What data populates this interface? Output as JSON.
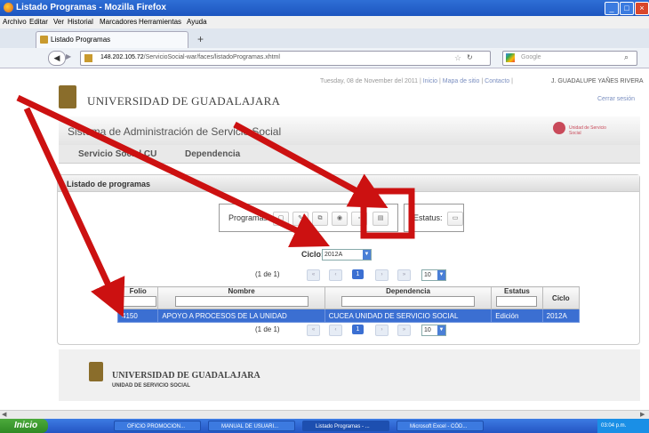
{
  "window": {
    "title": "Listado Programas - Mozilla Firefox"
  },
  "menu": [
    "Archivo",
    "Editar",
    "Ver",
    "Historial",
    "Marcadores",
    "Herramientas",
    "Ayuda"
  ],
  "tab": {
    "label": "Listado Programas",
    "new_tab": "+"
  },
  "address": {
    "host": "148.202.105.72",
    "path": "/ServicioSocial-war/faces/listadoProgramas.xhtml",
    "search_placeholder": "Google"
  },
  "site": {
    "brand": "UNIVERSIDAD DE GUADALAJARA",
    "date": "Tuesday, 08 de November del 2011",
    "links": [
      "Inicio",
      "Mapa de sitio",
      "Contacto"
    ],
    "user": "J. GUADALUPE YAÑES RIVERA",
    "logout": "Cerrar sesión",
    "system_title": "Sistema de Administración de Servicio Social",
    "logo_caption": "Unidad de Servicio Social",
    "nav": [
      "Servicio Social CU",
      "Dependencia"
    ]
  },
  "panel": {
    "title": "Listado de programas",
    "programs_label": "Programas",
    "status_label": "Estatus:",
    "cycle_label": "Ciclo:",
    "cycle_value": "2012A",
    "paginator": "(1 de 1)",
    "page": "1",
    "rows_per_page": "10",
    "columns": [
      "Folio",
      "Nombre",
      "Dependencia",
      "Estatus",
      "Ciclo"
    ],
    "rows": [
      {
        "folio": "4150",
        "nombre": "APOYO A PROCESOS DE LA UNIDAD",
        "dependencia": "CUCEA UNIDAD DE SERVICIO SOCIAL",
        "estatus": "Edición",
        "ciclo": "2012A"
      }
    ]
  },
  "footer": {
    "name": "UNIVERSIDAD DE GUADALAJARA",
    "unit": "UNIDAD DE SERVICIO SOCIAL"
  },
  "taskbar": {
    "start": "Inicio",
    "tasks": [
      "OFICIO PROMOCION...",
      "MANUAL DE USUARI...",
      "Listado Programas - ...",
      "Microsoft Excel - CÓD..."
    ],
    "clock": "03:04 p.m."
  },
  "colors": {
    "arrow": "#cc1111",
    "highlight_row": "#3b6fd2",
    "title_bar": "#1c55bf"
  }
}
